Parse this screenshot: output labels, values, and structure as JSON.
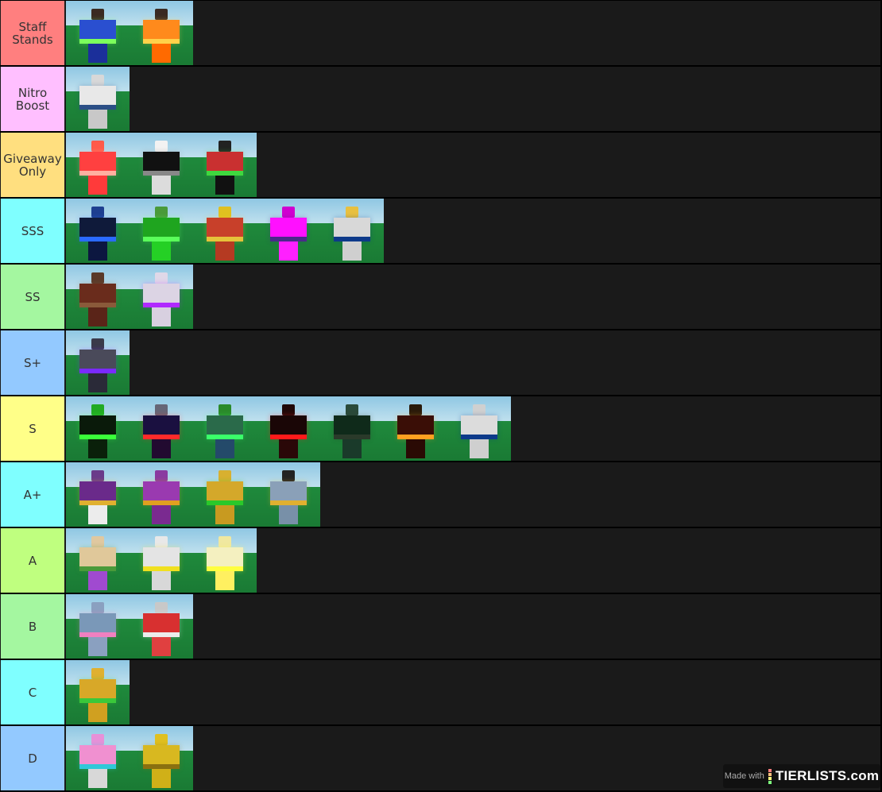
{
  "tiers": [
    {
      "label": "Staff Stands",
      "color": "#ff7f7f",
      "items": [
        {
          "name": "stand-blue-green",
          "head": "#3a2a22",
          "torso": "#2a4fd0",
          "legs": "#1b2f9a",
          "accent": "#7cff5c"
        },
        {
          "name": "stand-orange-glow",
          "head": "#3a2a22",
          "torso": "#ff8a1c",
          "legs": "#ff6a00",
          "accent": "#ffd24a"
        }
      ]
    },
    {
      "label": "Nitro Boost",
      "color": "#ffbfff",
      "items": [
        {
          "name": "stand-discord-white",
          "head": "#d8d8d8",
          "torso": "#e8e8e8",
          "legs": "#c8c8c8",
          "accent": "#2b4f86"
        }
      ]
    },
    {
      "label": "Giveaway Only",
      "color": "#ffdf7f",
      "items": [
        {
          "name": "stand-red-glow",
          "head": "#ff5a4a",
          "torso": "#ff4040",
          "legs": "#ff3a3a",
          "accent": "#ffb0a0"
        },
        {
          "name": "stand-black-shirt",
          "head": "#f2f2f2",
          "torso": "#111111",
          "legs": "#dcdcdc",
          "accent": "#888888"
        },
        {
          "name": "stand-red-shirt",
          "head": "#222222",
          "torso": "#c93030",
          "legs": "#111111",
          "accent": "#3fd83f"
        }
      ]
    },
    {
      "label": "SSS",
      "color": "#7fffff",
      "items": [
        {
          "name": "stand-dark-blue",
          "head": "#1e3f90",
          "torso": "#0f1a3a",
          "legs": "#0c1740",
          "accent": "#2a6aff"
        },
        {
          "name": "stand-green-glow",
          "head": "#4a9a3a",
          "torso": "#1fa51f",
          "legs": "#25d025",
          "accent": "#5aff5a"
        },
        {
          "name": "stand-red-yellow-pattern",
          "head": "#e0c020",
          "torso": "#c8402a",
          "legs": "#b53a22",
          "accent": "#e6c23a"
        },
        {
          "name": "stand-magenta-glow",
          "head": "#d000d0",
          "torso": "#ff10ff",
          "legs": "#ff20ff",
          "accent": "#4a2a8a"
        },
        {
          "name": "stand-white-blue",
          "head": "#e8c040",
          "torso": "#d8d8d8",
          "legs": "#cfcfcf",
          "accent": "#0d3a8a"
        }
      ]
    },
    {
      "label": "SS",
      "color": "#a4f7a0",
      "items": [
        {
          "name": "stand-brown",
          "head": "#5a3a2a",
          "torso": "#6a2c1c",
          "legs": "#5a2418",
          "accent": "#8a5a3a"
        },
        {
          "name": "stand-white-purple",
          "head": "#e0d8e8",
          "torso": "#dcd4e4",
          "legs": "#d8d0e0",
          "accent": "#b02aff"
        }
      ]
    },
    {
      "label": "S+",
      "color": "#93c9ff",
      "items": [
        {
          "name": "stand-dark-purple-glow",
          "head": "#3a3a4a",
          "torso": "#4a4a5a",
          "legs": "#2a2a38",
          "accent": "#7a2aff"
        }
      ]
    },
    {
      "label": "S",
      "color": "#ffff88",
      "items": [
        {
          "name": "stand-green-lattice",
          "head": "#22aa22",
          "torso": "#0a1a0a",
          "legs": "#0a200a",
          "accent": "#3aff3a"
        },
        {
          "name": "stand-dark-hearts",
          "head": "#666677",
          "torso": "#1a1040",
          "legs": "#220a30",
          "accent": "#ff2a2a"
        },
        {
          "name": "stand-green-hood",
          "head": "#2a8a2a",
          "torso": "#2a6a4a",
          "legs": "#244a6a",
          "accent": "#3aff6a"
        },
        {
          "name": "stand-red-black",
          "head": "#200808",
          "torso": "#1a0606",
          "legs": "#2a0808",
          "accent": "#ff1a1a"
        },
        {
          "name": "stand-dark-green-block",
          "head": "#2a4a3a",
          "torso": "#0f2a1a",
          "legs": "#1a3a2a",
          "accent": "#2a3a2a"
        },
        {
          "name": "stand-pumpkin",
          "head": "#2a1a0a",
          "torso": "#3a0e06",
          "legs": "#2a0a04",
          "accent": "#ffa020"
        },
        {
          "name": "stand-white-blue-2",
          "head": "#d0d0d0",
          "torso": "#dcdcdc",
          "legs": "#cfcfcf",
          "accent": "#0d3a8a"
        }
      ]
    },
    {
      "label": "A+",
      "color": "#7fffff",
      "items": [
        {
          "name": "stand-purple-gold",
          "head": "#6a3a8a",
          "torso": "#6a2a8a",
          "legs": "#ececec",
          "accent": "#e0b030"
        },
        {
          "name": "stand-purple-checker",
          "head": "#8a3aa0",
          "torso": "#9a3ab0",
          "legs": "#7a2a90",
          "accent": "#e0a020"
        },
        {
          "name": "stand-gold",
          "head": "#d8b030",
          "torso": "#d4a82a",
          "legs": "#c89a20",
          "accent": "#2ac82a"
        },
        {
          "name": "stand-gray-blue-coat",
          "head": "#222222",
          "torso": "#8aa0b8",
          "legs": "#7890a8",
          "accent": "#e0b030"
        }
      ]
    },
    {
      "label": "A",
      "color": "#bfff7f",
      "items": [
        {
          "name": "stand-tan-purple",
          "head": "#e0c8a0",
          "torso": "#e0c89a",
          "legs": "#a04ad0",
          "accent": "#4a9a3a"
        },
        {
          "name": "stand-white-yellow",
          "head": "#e8e8e8",
          "torso": "#e4e4e4",
          "legs": "#d8d8d8",
          "accent": "#f0e020"
        },
        {
          "name": "stand-white-yellow-glow",
          "head": "#f0e8a0",
          "torso": "#f4f0c0",
          "legs": "#fff060",
          "accent": "#ffff40"
        }
      ]
    },
    {
      "label": "B",
      "color": "#a4f7a0",
      "items": [
        {
          "name": "stand-pink-blue",
          "head": "#8aa0c0",
          "torso": "#7a98b8",
          "legs": "#8aa0c0",
          "accent": "#f080c0"
        },
        {
          "name": "stand-red-checker",
          "head": "#c8c8c8",
          "torso": "#d83030",
          "legs": "#e04040",
          "accent": "#ececec"
        }
      ]
    },
    {
      "label": "C",
      "color": "#7fffff",
      "items": [
        {
          "name": "stand-gold-grid",
          "head": "#e0b030",
          "torso": "#d8a828",
          "legs": "#d0a020",
          "accent": "#3ac83a"
        }
      ]
    },
    {
      "label": "D",
      "color": "#93c9ff",
      "items": [
        {
          "name": "stand-pink-white",
          "head": "#e890d8",
          "torso": "#f090d0",
          "legs": "#d8d8d8",
          "accent": "#30c8d8"
        },
        {
          "name": "stand-yellow",
          "head": "#e0c020",
          "torso": "#d8b820",
          "legs": "#d0b018",
          "accent": "#8a7010"
        }
      ]
    }
  ],
  "watermark": {
    "prefix": "Made with",
    "brand": "TIERLISTS.com",
    "bar_colors": [
      "#ff7f7f",
      "#ffbf7f",
      "#ffff7f",
      "#7fff7f"
    ]
  }
}
